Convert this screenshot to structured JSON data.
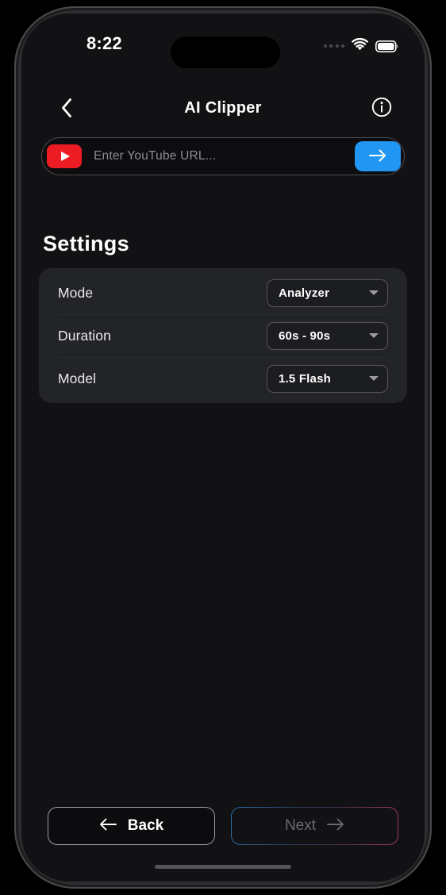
{
  "status_bar": {
    "time": "8:22",
    "signal_icon": "signal-dots-icon",
    "wifi_icon": "wifi-icon",
    "battery_icon": "battery-full-icon"
  },
  "header": {
    "back_icon": "chevron-left-icon",
    "title": "AI Clipper",
    "info_icon": "info-circle-icon"
  },
  "url_bar": {
    "source_icon": "youtube-icon",
    "placeholder": "Enter YouTube URL...",
    "value": "",
    "submit_icon": "arrow-right-icon",
    "submit_color": "#2196f3"
  },
  "settings": {
    "title": "Settings",
    "rows": [
      {
        "label": "Mode",
        "value": "Analyzer",
        "chevron_icon": "chevron-down-icon"
      },
      {
        "label": "Duration",
        "value": "60s - 90s",
        "chevron_icon": "chevron-down-icon"
      },
      {
        "label": "Model",
        "value": "1.5 Flash",
        "chevron_icon": "chevron-down-icon"
      }
    ]
  },
  "footer": {
    "back_label": "Back",
    "back_icon": "arrow-left-icon",
    "next_label": "Next",
    "next_icon": "arrow-right-icon",
    "next_disabled": true,
    "next_border_start": "#2e6fa8",
    "next_border_end": "#a23a5e"
  }
}
